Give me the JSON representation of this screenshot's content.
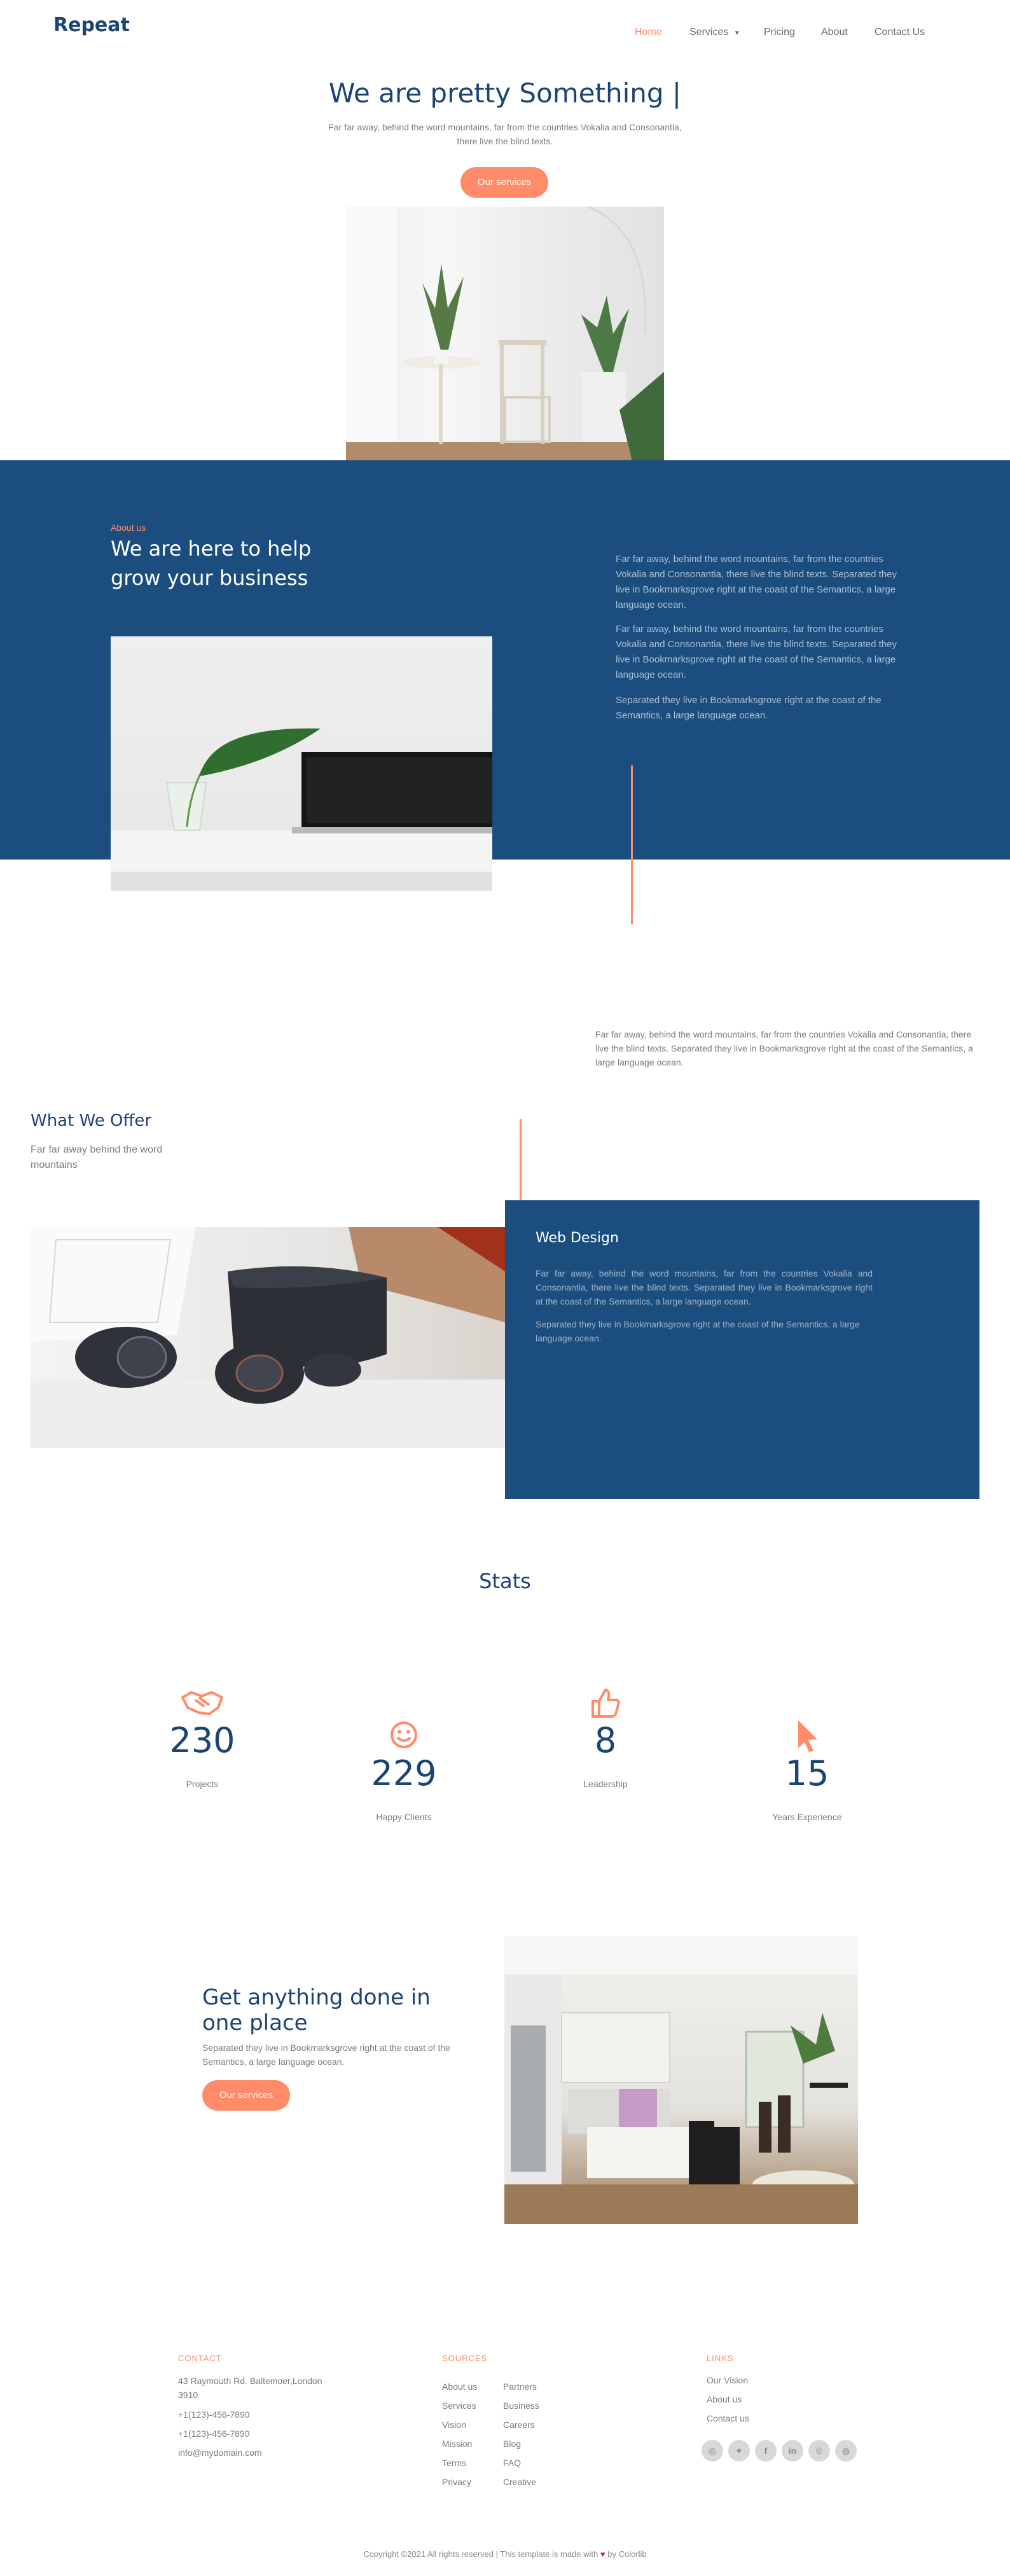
{
  "brand": {
    "name": "Repeat"
  },
  "nav": {
    "home": "Home",
    "services": "Services",
    "pricing": "Pricing",
    "about": "About",
    "contact": "Contact Us"
  },
  "hero": {
    "title": "We are pretty Something |",
    "subtitle_line1": "Far far away, behind the word mountains, far from the countries Vokalia and Consonantia,",
    "subtitle_line2": "there live the blind texts.",
    "button": "Our services"
  },
  "about": {
    "eyebrow": "About us",
    "title_line1": "We are here to help",
    "title_line2": "grow your business",
    "para1": "Far far away, behind the word mountains, far from the countries Vokalia and Consonantia, there live the blind texts. Separated they live in Bookmarksgrove right at the coast of the Semantics, a large language ocean.",
    "para2": "Far far away, behind the word mountains, far from the countries Vokalia and Consonantia, there live the blind texts. Separated they live in Bookmarksgrove right at the coast of the Semantics, a large language ocean.",
    "para3": "Separated they live in Bookmarksgrove right at the coast of the Semantics, a large language ocean."
  },
  "offer": {
    "side_text": "Far far away, behind the word mountains, far from the countries Vokalia and Consonantia, there live the blind texts. Separated they live in Bookmarksgrove right at the coast of the Semantics, a large language ocean.",
    "title": "What We Offer",
    "subtitle_line1": "Far far away behind the word",
    "subtitle_line2": "mountains",
    "card_title": "Web Design",
    "card_para1": "Far far away, behind the word mountains, far from the countries Vokalia and Consonantia, there live the blind texts. Separated they live in Bookmarksgrove right at the coast of the Semantics, a large language ocean.",
    "card_para2": "Separated they live in Bookmarksgrove right at the coast of the Semantics, a large language ocean."
  },
  "stats": {
    "title": "Stats",
    "items": [
      {
        "icon": "handshake-icon",
        "value": "230",
        "label": "Projects"
      },
      {
        "icon": "smile-icon",
        "value": "229",
        "label": "Happy Clients"
      },
      {
        "icon": "thumbs-up-icon",
        "value": "8",
        "label": "Leadership"
      },
      {
        "icon": "cursor-icon",
        "value": "15",
        "label": "Years Experience"
      }
    ]
  },
  "cta": {
    "title_line1": "Get anything done in",
    "title_line2": "one place",
    "text": "Separated they live in Bookmarksgrove right at the coast of the Semantics, a large language ocean.",
    "button": "Our services"
  },
  "footer": {
    "contact_heading": "CONTACT",
    "address": "43 Raymouth Rd. Baltemoer,London 3910",
    "phone1": "+1(123)-456-7890",
    "phone2": "+1(123)-456-7890",
    "email": "info@mydomain.com",
    "sources_heading": "SOURCES",
    "sources_col1": [
      "About us",
      "Services",
      "Vision",
      "Mission",
      "Terms",
      "Privacy"
    ],
    "sources_col2": [
      "Partners",
      "Business",
      "Careers",
      "Blog",
      "FAQ",
      "Creative"
    ],
    "links_heading": "LINKS",
    "links": [
      "Our Vision",
      "About us",
      "Contact us"
    ],
    "social": [
      "instagram-icon",
      "twitter-icon",
      "facebook-icon",
      "linkedin-icon",
      "pinterest-icon",
      "dribbble-icon"
    ],
    "copyright": "Copyright ©2021 All rights reserved | This template is made with",
    "by": "by Colorlib"
  },
  "colors": {
    "primary": "#1b4474",
    "accent": "#ff8b68",
    "text": "#7b7b7b"
  }
}
